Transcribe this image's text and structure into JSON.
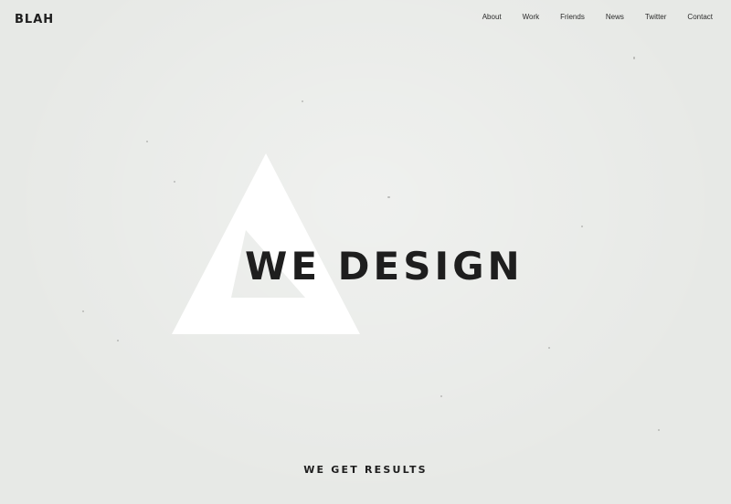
{
  "header": {
    "logo": "BLAH",
    "nav": [
      {
        "label": "About"
      },
      {
        "label": "Work"
      },
      {
        "label": "Friends"
      },
      {
        "label": "News"
      },
      {
        "label": "Twitter"
      },
      {
        "label": "Contact"
      }
    ]
  },
  "hero": {
    "headline": "WE DESIGN",
    "tagline": "WE GET RESULTS"
  },
  "colors": {
    "background": "#e7e9e6",
    "text": "#1e1e1e",
    "triangle": "#ffffff"
  }
}
